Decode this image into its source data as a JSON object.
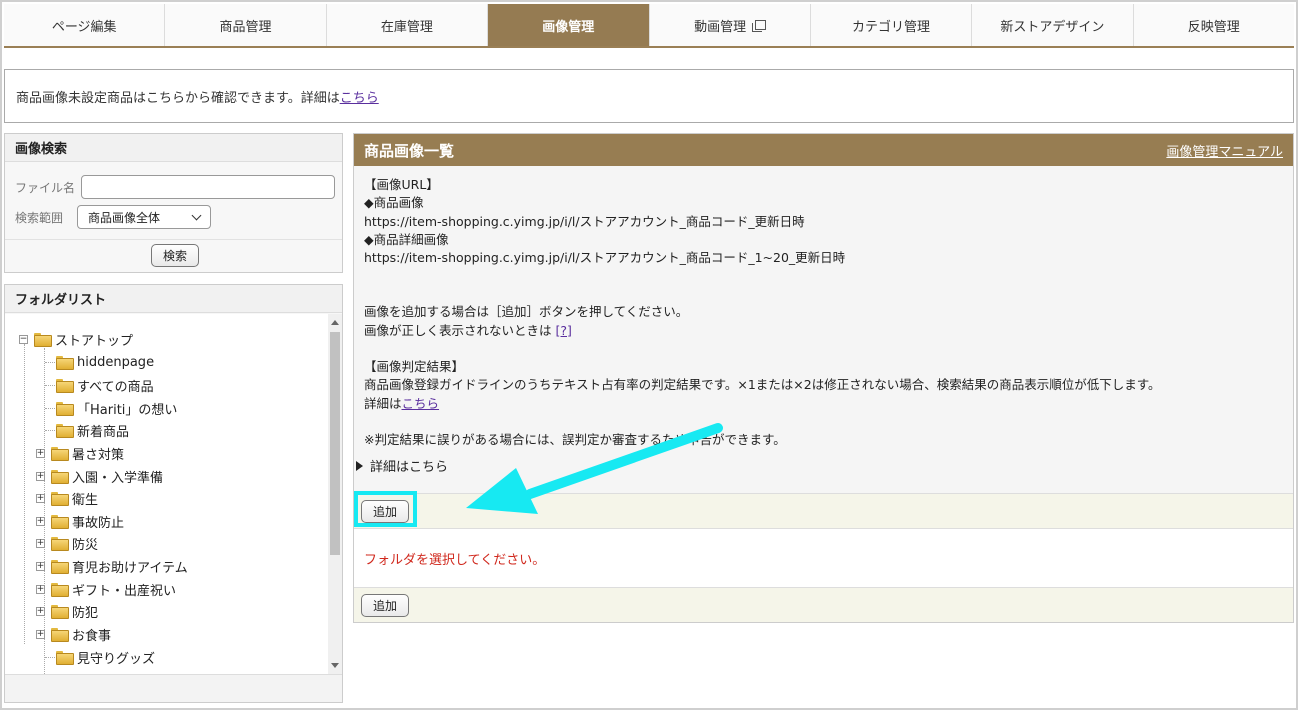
{
  "nav": {
    "tabs": [
      {
        "label": "ページ編集"
      },
      {
        "label": "商品管理"
      },
      {
        "label": "在庫管理"
      },
      {
        "label": "画像管理"
      },
      {
        "label": "動画管理"
      },
      {
        "label": "カテゴリ管理"
      },
      {
        "label": "新ストアデザイン"
      },
      {
        "label": "反映管理"
      }
    ]
  },
  "notice": {
    "text": "商品画像未設定商品はこちらから確認できます。詳細は",
    "link": "こちら"
  },
  "search": {
    "title": "画像検索",
    "filename_label": "ファイル名",
    "filename_value": "",
    "scope_label": "検索範囲",
    "scope_value": "商品画像全体",
    "button": "検索"
  },
  "folders": {
    "title": "フォルダリスト",
    "root": "ストアトップ",
    "items": [
      {
        "label": "hiddenpage"
      },
      {
        "label": "すべての商品"
      },
      {
        "label": "「Hariti」の想い"
      },
      {
        "label": "新着商品"
      },
      {
        "label": "暑さ対策"
      },
      {
        "label": "入園・入学準備"
      },
      {
        "label": "衛生"
      },
      {
        "label": "事故防止"
      },
      {
        "label": "防災"
      },
      {
        "label": "育児お助けアイテム"
      },
      {
        "label": "ギフト・出産祝い"
      },
      {
        "label": "防犯"
      },
      {
        "label": "お食事"
      },
      {
        "label": "見守りグッズ"
      }
    ]
  },
  "main": {
    "title": "商品画像一覧",
    "manual_link": "画像管理マニュアル",
    "info": {
      "url_heading": "【画像URL】",
      "product_image_label": "◆商品画像",
      "product_image_url": "https://item-shopping.c.yimg.jp/i/l/ストアアカウント_商品コード_更新日時",
      "detail_image_label": "◆商品詳細画像",
      "detail_image_url": "https://item-shopping.c.yimg.jp/i/l/ストアアカウント_商品コード_1~20_更新日時",
      "add_hint": "画像を追加する場合は［追加］ボタンを押してください。",
      "display_hint": "画像が正しく表示されないときは ",
      "display_hint_link": "[?]",
      "judge_heading": "【画像判定結果】",
      "judge_text": "商品画像登録ガイドラインのうちテキスト占有率の判定結果です。×1または×2は修正されない場合、検索結果の商品表示順位が低下します。",
      "judge_detail": "詳細は",
      "judge_detail_link": "こちら",
      "judge_note": "※判定結果に誤りがある場合には、誤判定か審査するため申告ができます。"
    },
    "details_toggle": "詳細はこちら",
    "add_button": "追加",
    "message": "フォルダを選択してください。",
    "add_button_bottom": "追加"
  },
  "colors": {
    "accent": "#957b52",
    "highlight": "#17e9f2",
    "error": "#d0281d"
  }
}
